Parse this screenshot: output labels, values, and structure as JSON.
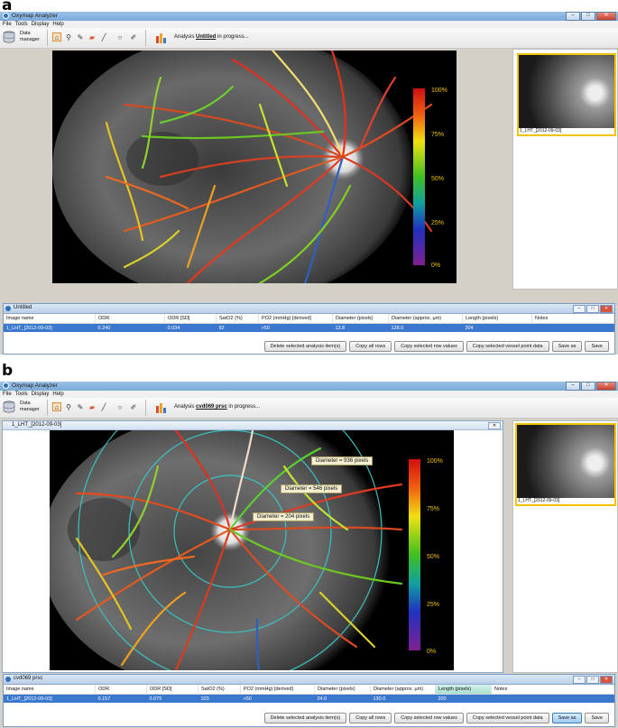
{
  "panel_a": {
    "label": "a",
    "app_title": "Oxymap Analyzer",
    "menu": [
      "File",
      "Tools",
      "Display",
      "Help"
    ],
    "toolbar": {
      "data_manager_line1": "Data",
      "data_manager_line2": "manager",
      "analysis_prefix": "Analysis",
      "analysis_name": "Untitled",
      "analysis_suffix": "in progress..."
    },
    "colorbar_ticks": [
      "100%",
      "75%",
      "50%",
      "25%",
      "0%"
    ],
    "thumbnail_label": "1_LHT_[2012-09-03]",
    "results_window": {
      "title": "Untitled",
      "columns": [
        "Image name",
        "ODR",
        "ODR [SD]",
        "SatO2 (%)",
        "PO2 (mmHg) [derived]",
        "Diameter (pixels)",
        "Diameter (approx. µm)",
        "Length (pixels)",
        "Notes"
      ],
      "row": [
        "1_LHT_[2012-09-03]",
        "0.240",
        "0.034",
        "92",
        ">50",
        "13.8",
        "128.0",
        "204",
        ""
      ],
      "buttons": [
        "Delete selected analysis item(s)",
        "Copy all rows",
        "Copy selected row values",
        "Copy selected vessel point data",
        "Save as",
        "Save"
      ]
    }
  },
  "panel_b": {
    "label": "b",
    "app_title": "Oxymap Analyzer",
    "menu": [
      "File",
      "Tools",
      "Display",
      "Help"
    ],
    "toolbar": {
      "data_manager_line1": "Data",
      "data_manager_line2": "manager",
      "analysis_prefix": "Analysis",
      "analysis_name": "cvd069 prsc",
      "analysis_suffix": "in progress..."
    },
    "image_window_title": "1_LHT_[2012-09-03]",
    "colorbar_ticks": [
      "100%",
      "75%",
      "50%",
      "25%",
      "0%"
    ],
    "callouts": [
      "Diameter = 936 pixels",
      "Diameter = 546 pixels",
      "Diameter = 204 pixels"
    ],
    "thumbnail_label": "1_LHT_[2012-09-03]",
    "results_window": {
      "title": "cvd069 prsc",
      "columns": [
        "Image name",
        "ODR",
        "ODR [SD]",
        "SatO2 (%)",
        "PO2 (mmHg) [derived]",
        "Diameter (pixels)",
        "Diameter (approx. µm)",
        "Length (pixels)",
        "Notes"
      ],
      "row": [
        "1_LHT_[2012-09-03]",
        "0.157",
        "0.075",
        "103",
        ">50",
        "24.0",
        "130.0",
        "200",
        ""
      ],
      "buttons": [
        "Delete selected analysis item(s)",
        "Copy all rows",
        "Copy selected row values",
        "Copy selected vessel point data",
        "Save as",
        "Save"
      ]
    }
  },
  "colors": {
    "selection": "#3a78d0",
    "highlight": "#f2c200",
    "vessel_high": "#d42a1a",
    "vessel_mid": "#55c81e",
    "vessel_low": "#2a3a9e",
    "ring": "#38c4c0"
  }
}
